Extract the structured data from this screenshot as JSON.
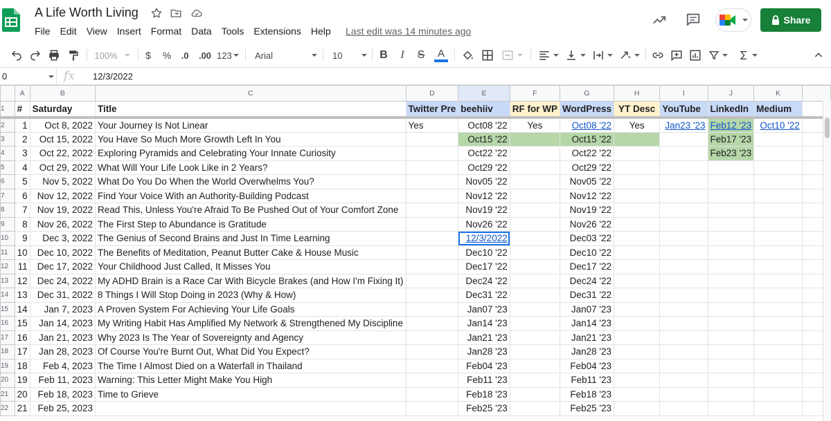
{
  "header": {
    "title": "A Life Worth Living",
    "last_edit": "Last edit was 14 minutes ago",
    "share_label": "Share",
    "menu": [
      "File",
      "Edit",
      "View",
      "Insert",
      "Format",
      "Data",
      "Tools",
      "Extensions",
      "Help"
    ]
  },
  "toolbar": {
    "zoom": "100%",
    "currency": "$",
    "percent": "%",
    "decrease_decimal": ".0",
    "increase_decimal": ".00",
    "more_formats": "123",
    "font": "Arial",
    "font_size": "10",
    "bold": "B",
    "italic": "I",
    "strike": "S",
    "text_color": "A"
  },
  "formula_bar": {
    "name_box": "0",
    "fx": "fx",
    "value": "12/3/2022"
  },
  "grid": {
    "column_letters": [
      "A",
      "B",
      "C",
      "D",
      "E",
      "F",
      "G",
      "H",
      "I",
      "J",
      "K",
      ""
    ],
    "headers": [
      "#",
      "Saturday",
      "Title",
      "Twitter Pre",
      "beehiiv",
      "RF for WP",
      "WordPress",
      "YT Desc",
      "YouTube",
      "LinkedIn",
      "Medium"
    ],
    "row_numbers": [
      "1",
      "2",
      "3",
      "4",
      "5",
      "6",
      "7",
      "8",
      "9",
      "10",
      "11",
      "12",
      "13",
      "14",
      "15",
      "16",
      "17",
      "18",
      "19",
      "20",
      "21",
      "22"
    ],
    "rows": [
      {
        "n": "1",
        "date": "Oct 8, 2022",
        "title": "Your Journey Is Not Linear",
        "tw": "Yes",
        "bee": "Oct08 '22",
        "rf": "Yes",
        "wp": "Oct08 '22",
        "yt": "Yes",
        "ytb": "Jan23 '23",
        "li": "Feb12 '23",
        "md": "Oct10 '22"
      },
      {
        "n": "2",
        "date": "Oct 15, 2022",
        "title": "You Have So Much More Growth Left In You",
        "tw": "",
        "bee": "Oct15 '22",
        "rf": "",
        "wp": "Oct15 '22",
        "yt": "",
        "ytb": "",
        "li": "Feb17 '23",
        "md": ""
      },
      {
        "n": "3",
        "date": "Oct 22, 2022",
        "title": "Exploring Pyramids and Celebrating Your Innate Curiosity",
        "tw": "",
        "bee": "Oct22 '22",
        "rf": "",
        "wp": "Oct22 '22",
        "yt": "",
        "ytb": "",
        "li": "Feb23 '23",
        "md": ""
      },
      {
        "n": "4",
        "date": "Oct 29, 2022",
        "title": "What Will Your Life Look Like in 2 Years?",
        "tw": "",
        "bee": "Oct29 '22",
        "rf": "",
        "wp": "Oct29 '22",
        "yt": "",
        "ytb": "",
        "li": "",
        "md": ""
      },
      {
        "n": "5",
        "date": "Nov 5, 2022",
        "title": "What Do You Do When the World Overwhelms You?",
        "tw": "",
        "bee": "Nov05 '22",
        "rf": "",
        "wp": "Nov05 '22",
        "yt": "",
        "ytb": "",
        "li": "",
        "md": ""
      },
      {
        "n": "6",
        "date": "Nov 12, 2022",
        "title": "Find Your Voice With an Authority-Building Podcast",
        "tw": "",
        "bee": "Nov12 '22",
        "rf": "",
        "wp": "Nov12 '22",
        "yt": "",
        "ytb": "",
        "li": "",
        "md": ""
      },
      {
        "n": "7",
        "date": "Nov 19, 2022",
        "title": "Read This, Unless You're Afraid To Be Pushed Out of Your Comfort Zone",
        "tw": "",
        "bee": "Nov19 '22",
        "rf": "",
        "wp": "Nov19 '22",
        "yt": "",
        "ytb": "",
        "li": "",
        "md": ""
      },
      {
        "n": "8",
        "date": "Nov 26, 2022",
        "title": "The First Step to Abundance is Gratitude",
        "tw": "",
        "bee": "Nov26 '22",
        "rf": "",
        "wp": "Nov26 '22",
        "yt": "",
        "ytb": "",
        "li": "",
        "md": ""
      },
      {
        "n": "9",
        "date": "Dec 3, 2022",
        "title": "The Genius of Second Brains and Just In Time Learning",
        "tw": "",
        "bee": "12/3/2022",
        "rf": "",
        "wp": "Dec03 '22",
        "yt": "",
        "ytb": "",
        "li": "",
        "md": ""
      },
      {
        "n": "10",
        "date": "Dec 10, 2022",
        "title": "The Benefits of Meditation, Peanut Butter Cake & House Music",
        "tw": "",
        "bee": "Dec10 '22",
        "rf": "",
        "wp": "Dec10 '22",
        "yt": "",
        "ytb": "",
        "li": "",
        "md": ""
      },
      {
        "n": "11",
        "date": "Dec 17, 2022",
        "title": "Your Childhood Just Called, It Misses You",
        "tw": "",
        "bee": "Dec17 '22",
        "rf": "",
        "wp": "Dec17 '22",
        "yt": "",
        "ytb": "",
        "li": "",
        "md": ""
      },
      {
        "n": "12",
        "date": "Dec 24, 2022",
        "title": "My ADHD Brain is a Race Car With Bicycle Brakes (and How I'm Fixing It)",
        "tw": "",
        "bee": "Dec24 '22",
        "rf": "",
        "wp": "Dec24 '22",
        "yt": "",
        "ytb": "",
        "li": "",
        "md": ""
      },
      {
        "n": "13",
        "date": "Dec 31, 2022",
        "title": "8 Things I Will Stop Doing in 2023 (Why & How)",
        "tw": "",
        "bee": "Dec31 '22",
        "rf": "",
        "wp": "Dec31 '22",
        "yt": "",
        "ytb": "",
        "li": "",
        "md": ""
      },
      {
        "n": "14",
        "date": "Jan 7, 2023",
        "title": "A Proven System For Achieving Your Life Goals",
        "tw": "",
        "bee": "Jan07 '23",
        "rf": "",
        "wp": "Jan07 '23",
        "yt": "",
        "ytb": "",
        "li": "",
        "md": ""
      },
      {
        "n": "15",
        "date": "Jan 14, 2023",
        "title": "My Writing Habit Has Amplified My Network & Strengthened My Discipline",
        "tw": "",
        "bee": "Jan14 '23",
        "rf": "",
        "wp": "Jan14 '23",
        "yt": "",
        "ytb": "",
        "li": "",
        "md": ""
      },
      {
        "n": "16",
        "date": "Jan 21, 2023",
        "title": "Why 2023 Is The Year of Sovereignty and Agency",
        "tw": "",
        "bee": "Jan21 '23",
        "rf": "",
        "wp": "Jan21 '23",
        "yt": "",
        "ytb": "",
        "li": "",
        "md": ""
      },
      {
        "n": "17",
        "date": "Jan 28, 2023",
        "title": "Of Course You're Burnt Out, What Did You Expect?",
        "tw": "",
        "bee": "Jan28 '23",
        "rf": "",
        "wp": "Jan28 '23",
        "yt": "",
        "ytb": "",
        "li": "",
        "md": ""
      },
      {
        "n": "18",
        "date": "Feb 4, 2023",
        "title": "The Time I Almost Died on a Waterfall in Thailand",
        "tw": "",
        "bee": "Feb04 '23",
        "rf": "",
        "wp": "Feb04 '23",
        "yt": "",
        "ytb": "",
        "li": "",
        "md": ""
      },
      {
        "n": "19",
        "date": "Feb 11, 2023",
        "title": "Warning: This Letter Might Make You High",
        "tw": "",
        "bee": "Feb11 '23",
        "rf": "",
        "wp": "Feb11 '23",
        "yt": "",
        "ytb": "",
        "li": "",
        "md": ""
      },
      {
        "n": "20",
        "date": "Feb 18, 2023",
        "title": "Time to Grieve",
        "tw": "",
        "bee": "Feb18 '23",
        "rf": "",
        "wp": "Feb18 '23",
        "yt": "",
        "ytb": "",
        "li": "",
        "md": ""
      },
      {
        "n": "21",
        "date": "Feb 25, 2023",
        "title": "",
        "tw": "",
        "bee": "Feb25 '23",
        "rf": "",
        "wp": "Feb25 '23",
        "yt": "",
        "ytb": "",
        "li": "",
        "md": ""
      }
    ]
  },
  "colors": {
    "header_blue": "#c9daf8",
    "header_yellow": "#fff2cc",
    "cell_green": "#b6d7a8",
    "share_green": "#188038",
    "link_blue": "#1155cc",
    "selection_blue": "#1a73e8"
  }
}
